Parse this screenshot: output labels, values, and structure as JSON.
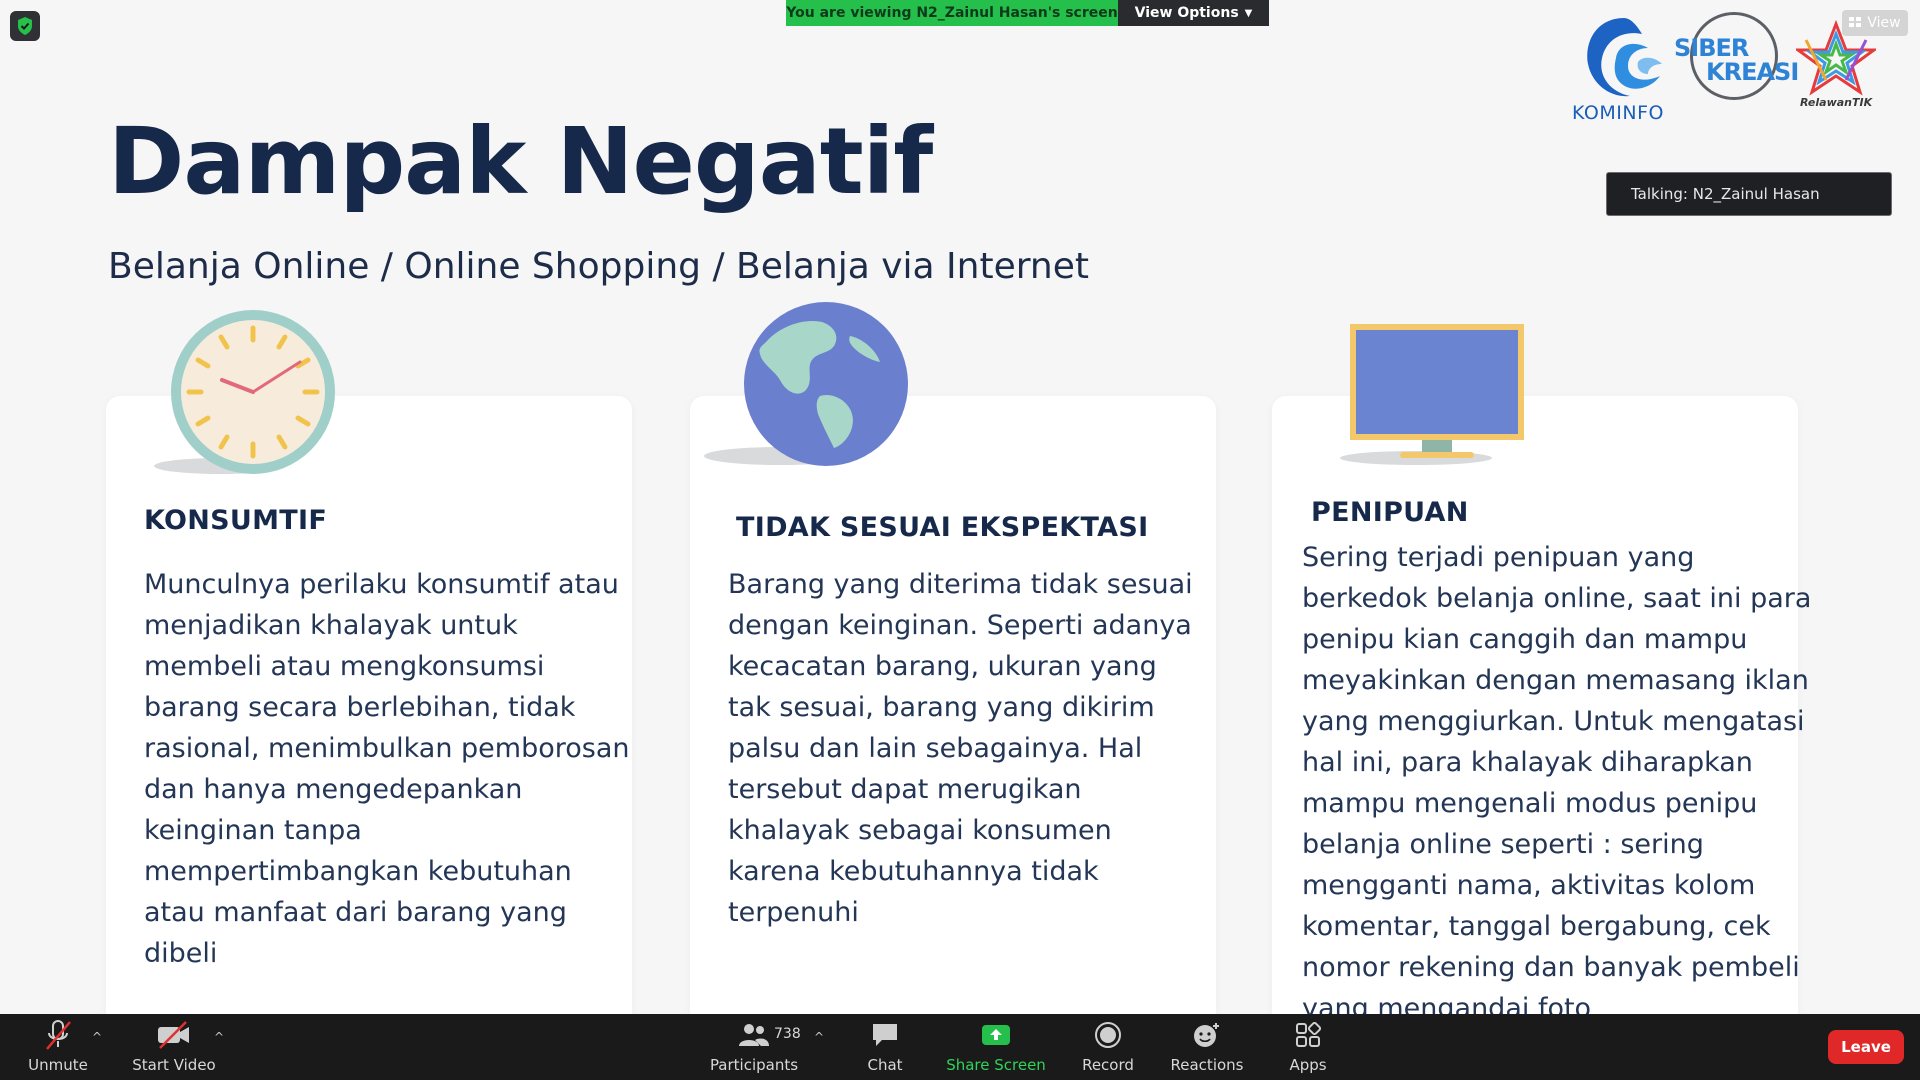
{
  "banner": {
    "viewing_text": "You are viewing N2_Zainul Hasan's screen",
    "view_options_label": "View Options"
  },
  "logos": {
    "kominfo": "KOMINFO",
    "siber_1": "SIBER",
    "siber_2": "KREASI",
    "relawan": "RelawanTIK"
  },
  "view_button_label": "View",
  "talking_indicator": "Talking: N2_Zainul Hasan",
  "slide": {
    "title": "Dampak Negatif",
    "subtitle": "Belanja Online / Online Shopping / Belanja via Internet",
    "cards": [
      {
        "icon": "clock-icon",
        "heading": "KONSUMTIF",
        "lines": [
          "Munculnya perilaku konsumtif atau",
          "menjadikan khalayak untuk",
          "membeli atau mengkonsumsi",
          "barang secara berlebihan, tidak",
          "rasional, menimbulkan pemborosan",
          "dan hanya mengedepankan",
          "keinginan tanpa",
          "mempertimbangkan kebutuhan",
          "atau manfaat dari barang yang",
          "dibeli"
        ]
      },
      {
        "icon": "globe-icon",
        "heading": "TIDAK SESUAI EKSPEKTASI",
        "lines": [
          "Barang yang diterima tidak sesuai",
          "dengan keinginan. Seperti adanya",
          "kecacatan barang, ukuran yang",
          "tak sesuai, barang yang dikirim",
          "palsu dan lain sebagainya. Hal",
          "tersebut dapat merugikan",
          "khalayak sebagai konsumen",
          "karena kebutuhannya tidak",
          "terpenuhi"
        ]
      },
      {
        "icon": "monitor-icon",
        "heading": "PENIPUAN",
        "lines": [
          "Sering terjadi penipuan yang",
          "berkedok belanja online, saat ini para",
          "penipu kian canggih dan mampu",
          "meyakinkan dengan memasang iklan",
          "yang menggiurkan. Untuk mengatasi",
          "hal ini, para khalayak diharapkan",
          "mampu mengenali modus penipu",
          "belanja online seperti : sering",
          "mengganti nama, aktivitas kolom",
          "komentar, tanggal bergabung, cek",
          "nomor rekening dan banyak pembeli",
          "yang mengandai foto"
        ]
      }
    ]
  },
  "toolbar": {
    "unmute": "Unmute",
    "start_video": "Start Video",
    "participants": "Participants",
    "participants_count": "738",
    "chat": "Chat",
    "share_screen": "Share Screen",
    "record": "Record",
    "reactions": "Reactions",
    "apps": "Apps",
    "leave": "Leave"
  },
  "colors": {
    "title": "#16294a",
    "banner_green": "#24c04b",
    "share_green": "#24c04b",
    "leave_red": "#e02828",
    "toolbar_bg": "#1a1a1a"
  }
}
